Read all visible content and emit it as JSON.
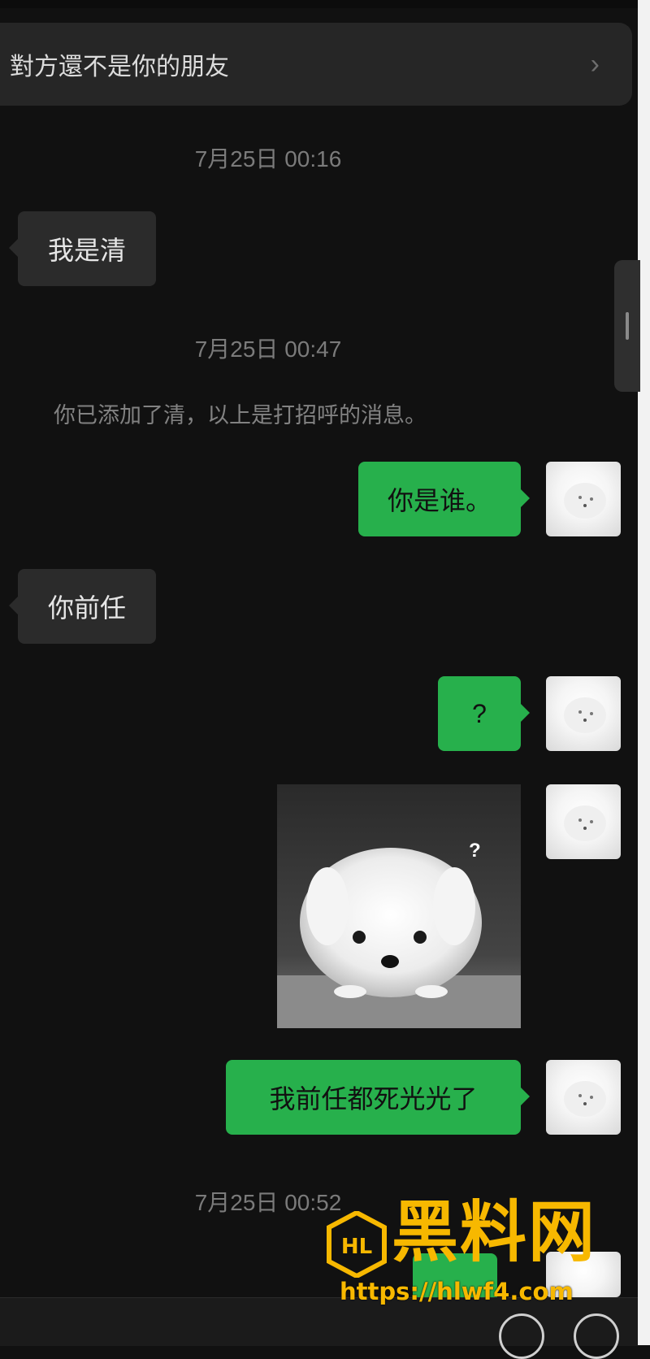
{
  "notice": {
    "text": "對方還不是你的朋友",
    "chevron": "›"
  },
  "chat": {
    "timestamps": [
      "7月25日 00:16",
      "7月25日 00:47",
      "7月25日 00:52"
    ],
    "system_message": "你已添加了清，以上是打招呼的消息。",
    "messages": [
      {
        "from": "them",
        "text": "我是清"
      },
      {
        "from": "me",
        "text": "你是谁。"
      },
      {
        "from": "them",
        "text": "你前任"
      },
      {
        "from": "me",
        "text": "?"
      },
      {
        "from": "me",
        "type": "image",
        "overlay_text": "?"
      },
      {
        "from": "me",
        "text": "我前任都死光光了"
      }
    ]
  },
  "watermark": {
    "title": "黑料网",
    "url": "https://hlwf4.com",
    "logo_text": "HL"
  },
  "icons": {
    "emoji": "emoji-icon",
    "more": "plus-icon"
  },
  "colors": {
    "background": "#111111",
    "incoming_bubble": "#2b2b2b",
    "outgoing_bubble": "#27b04c",
    "watermark": "#f7b800"
  }
}
